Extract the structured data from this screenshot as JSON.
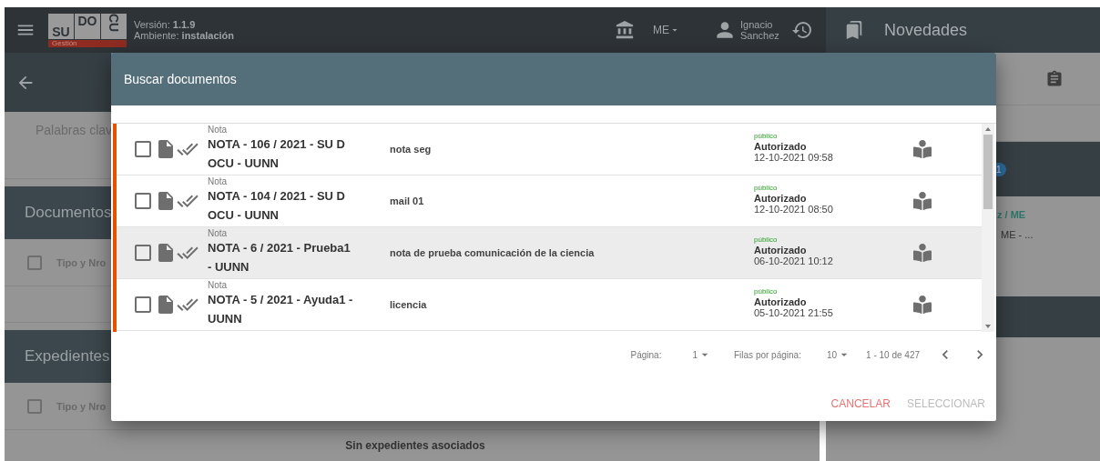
{
  "header": {
    "logo": {
      "letters": [
        "SU",
        "DO",
        "CU"
      ],
      "subtitle": "Gestión"
    },
    "version": "Versión: **1.1.9**",
    "environment": "Ambiente: **instalación**",
    "org": "ME",
    "user": "Ignacio Sanchez"
  },
  "novedades": {
    "title": "Novedades",
    "badge": "1",
    "link": "z / ME",
    "snippet": "ME - ..."
  },
  "background": {
    "keywords_placeholder": "Palabras clav",
    "sections": [
      {
        "title": "Documentos",
        "column": "Tipo y Nro",
        "checked": false
      },
      {
        "title": "Expedientes",
        "column": "Tipo y Nro",
        "checked": false,
        "empty": "Sin expedientes asociados"
      }
    ]
  },
  "modal": {
    "title": "Buscar documentos",
    "rows": [
      {
        "type": "Nota",
        "number": "NOTA - 106 / 2021 - SU DOCU - UUNN",
        "title": "nota seg",
        "visibility": "público",
        "state": "Autorizado",
        "date": "12-10-2021 09:58",
        "checked": false,
        "selected": false
      },
      {
        "type": "Nota",
        "number": "NOTA - 104 / 2021 - SU DOCU - UUNN",
        "title": "mail 01",
        "visibility": "público",
        "state": "Autorizado",
        "date": "12-10-2021 08:50",
        "checked": false,
        "selected": false
      },
      {
        "type": "Nota",
        "number": "NOTA - 6 / 2021 - Prueba1 - UUNN",
        "title": "nota de prueba comunicación de la ciencia",
        "visibility": "público",
        "state": "Autorizado",
        "date": "06-10-2021 10:12",
        "checked": false,
        "selected": true
      },
      {
        "type": "Nota",
        "number": "NOTA - 5 / 2021 - Ayuda1 - UUNN",
        "title": "licencia",
        "visibility": "público",
        "state": "Autorizado",
        "date": "05-10-2021 21:55",
        "checked": false,
        "selected": false
      }
    ],
    "pagination": {
      "page_label": "Página:",
      "page": "1",
      "rows_label": "Filas por página:",
      "rows": "10",
      "range": "1 - 10 de 427"
    },
    "actions": [
      {
        "label": "CANCELAR",
        "kind": "cancel",
        "disabled": false
      },
      {
        "label": "SELECCIONAR",
        "kind": "confirm",
        "disabled": true
      }
    ]
  }
}
